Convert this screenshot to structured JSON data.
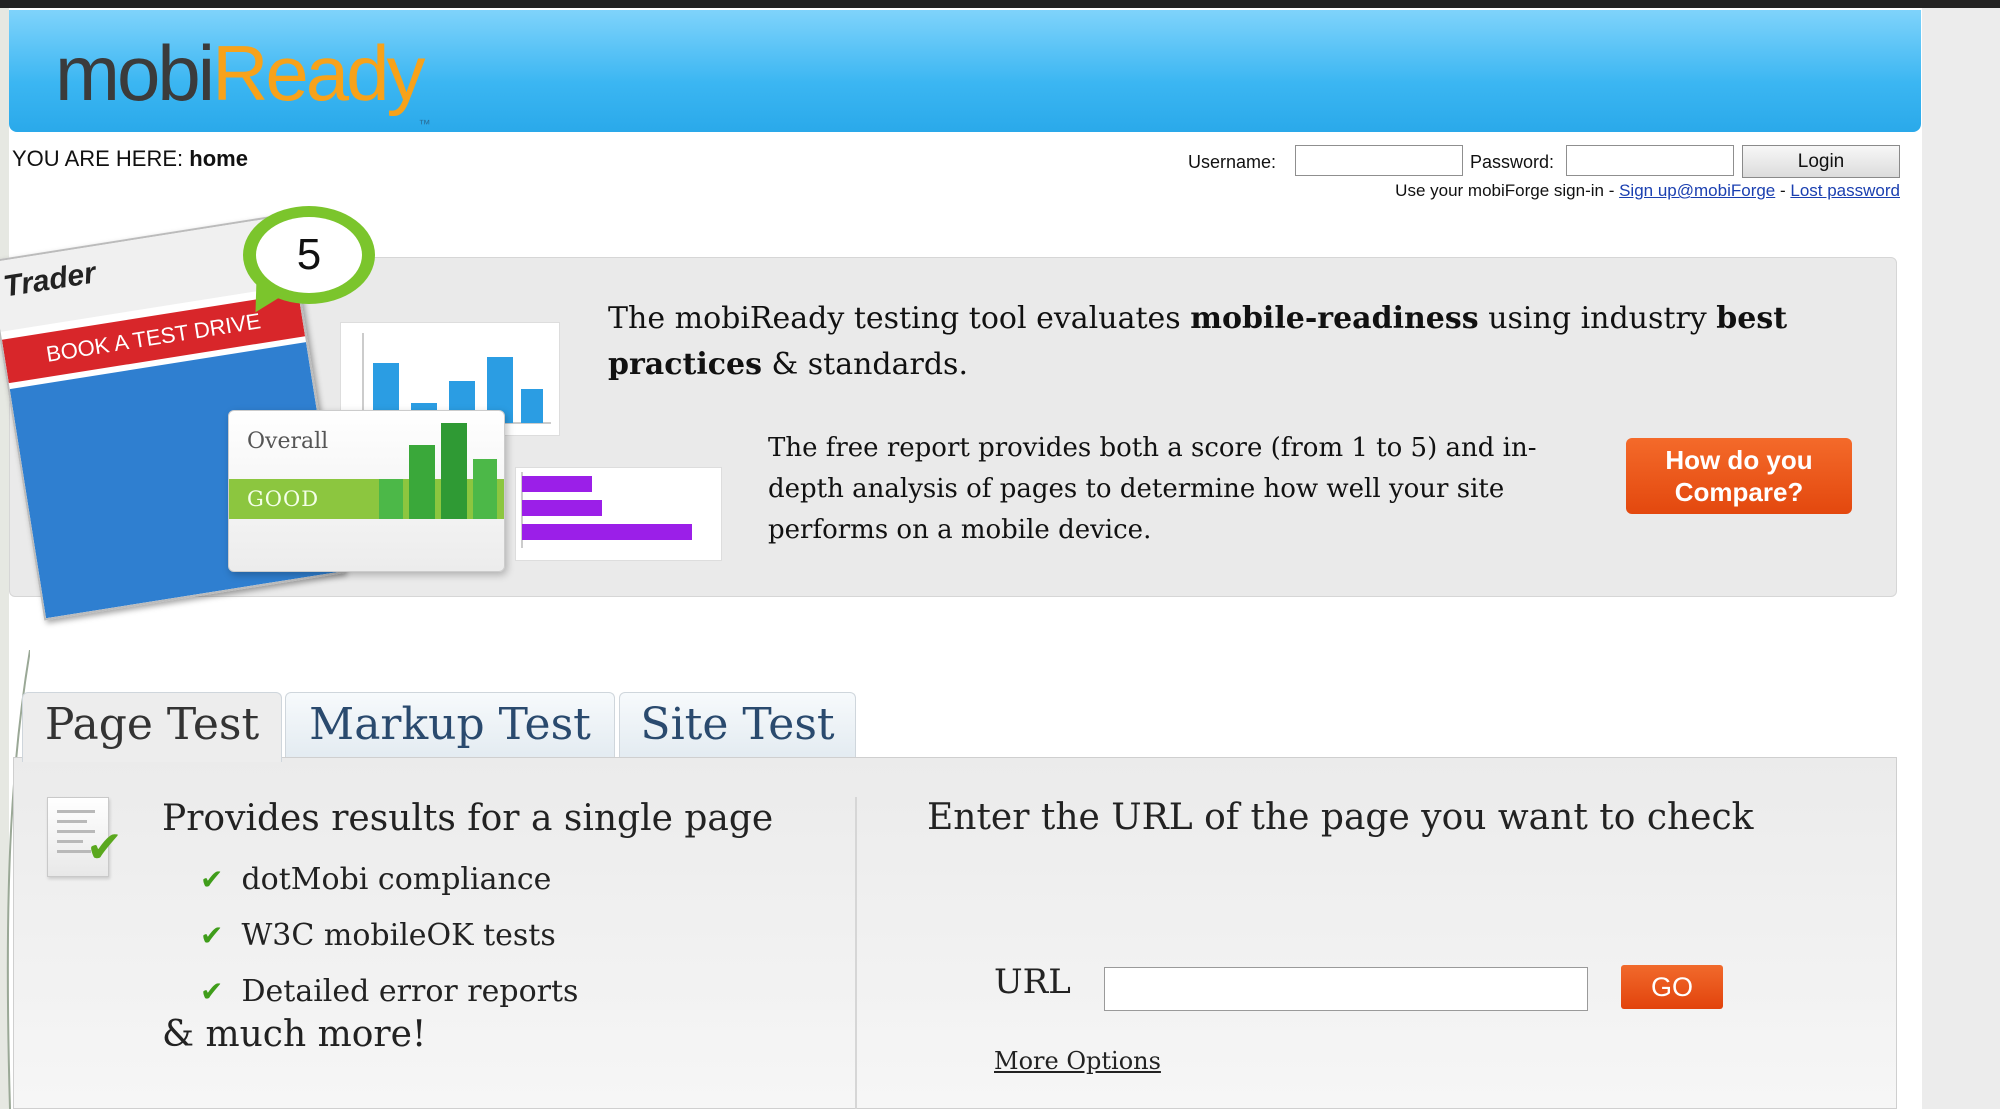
{
  "header": {
    "logo_part1": "mobi",
    "logo_part2": "Ready",
    "logo_tm": "™"
  },
  "breadcrumb": {
    "prefix": "YOU ARE HERE: ",
    "current": "home"
  },
  "login": {
    "username_label": "Username:",
    "password_label": "Password:",
    "username_value": "",
    "password_value": "",
    "login_button": "Login",
    "signin_text": "Use your mobiForge sign-in - ",
    "signup_link": "Sign up@mobiForge",
    "separator": " - ",
    "lost_password_link": "Lost password"
  },
  "banner": {
    "score_badge": "5",
    "phone_brand": "Trader",
    "phone_button": "BOOK A TEST DRIVE",
    "card_label": "Overall",
    "card_rating": "GOOD",
    "lead_part1": "The mobiReady testing tool evaluates ",
    "lead_bold1": "mobile-readiness",
    "lead_part2": " using industry ",
    "lead_bold2": "best practices",
    "lead_part3": " & standards.",
    "description": "The free report provides both a score (from 1 to 5) and in-depth analysis of pages to determine how well your site performs on a mobile device.",
    "compare_button_line1": "How do you",
    "compare_button_line2": "Compare?"
  },
  "tabs": [
    {
      "label": "Page Test",
      "active": true
    },
    {
      "label": "Markup Test",
      "active": false
    },
    {
      "label": "Site Test",
      "active": false
    }
  ],
  "panel": {
    "left_title": "Provides results for a single page",
    "features": [
      "dotMobi compliance",
      "W3C mobileOK tests",
      "Detailed error reports"
    ],
    "more": "& much more!",
    "right_title": "Enter the URL of the page you want to check",
    "url_label": "URL",
    "url_value": "",
    "go_button": "GO",
    "more_options": "More Options"
  },
  "icons": {
    "check": "check-icon",
    "document": "document-check-icon"
  },
  "colors": {
    "header_blue": "#3bb6f2",
    "logo_orange": "#f7a21a",
    "button_orange": "#e3480e",
    "check_green": "#3f9d1a",
    "tab_text_blue": "#2a4a6e"
  }
}
